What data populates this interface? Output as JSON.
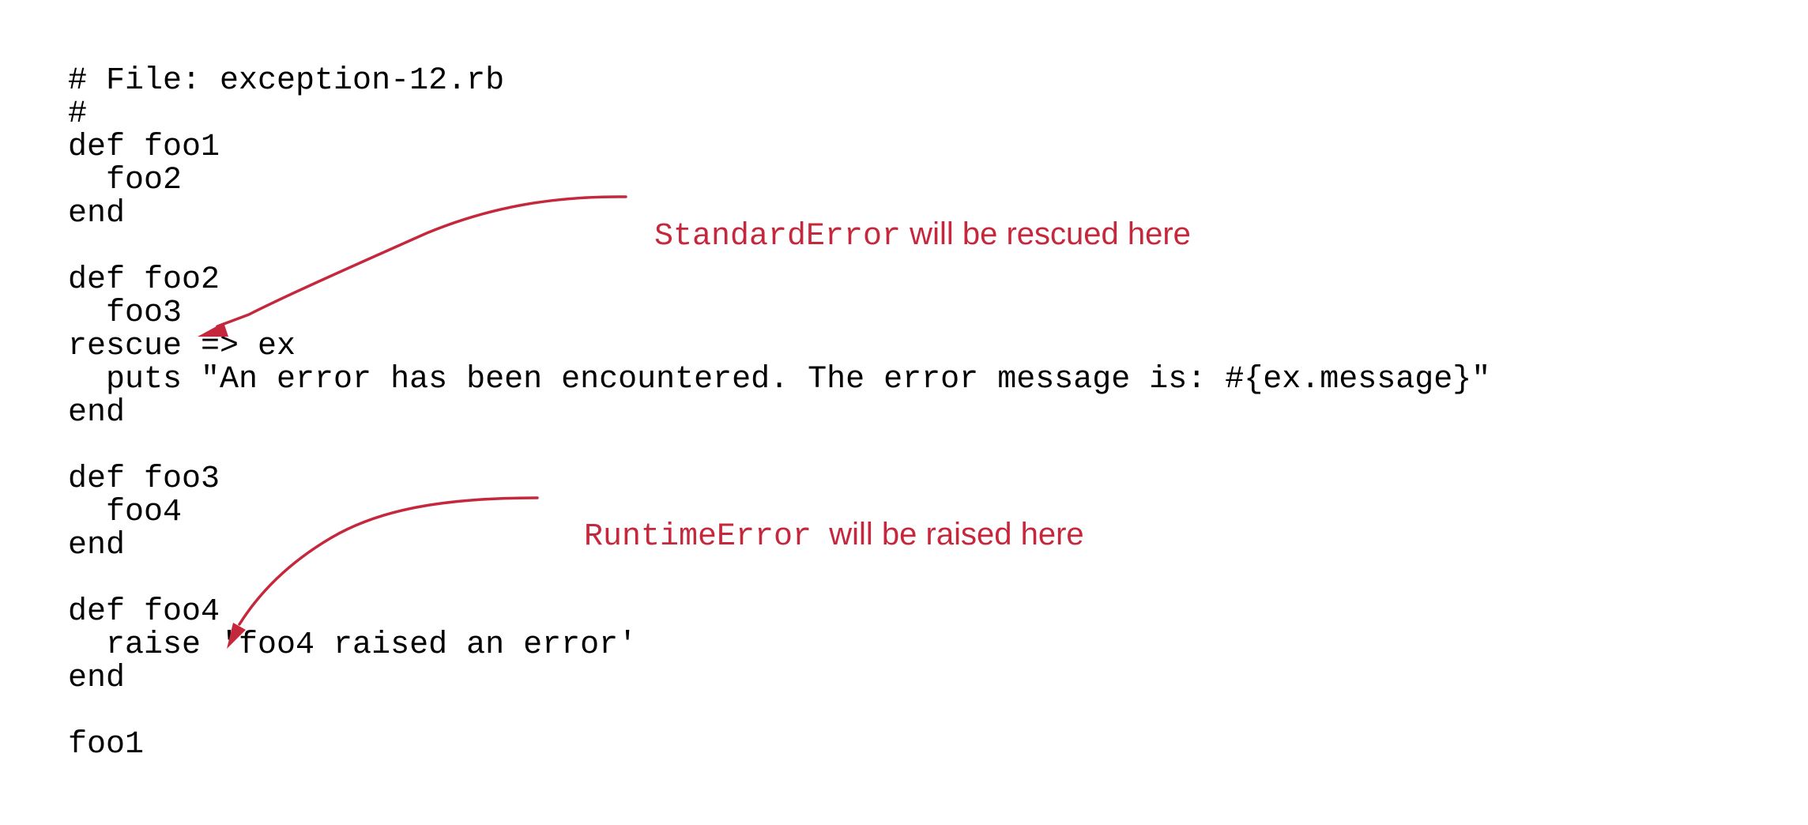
{
  "code_lines": [
    "# File: exception-12.rb",
    "#",
    "def foo1",
    "  foo2",
    "end",
    "",
    "def foo2",
    "  foo3",
    "rescue => ex",
    "  puts \"An error has been encountered. The error message is: #{ex.message}\"",
    "end",
    "",
    "def foo3",
    "  foo4",
    "end",
    "",
    "def foo4",
    "  raise 'foo4 raised an error'",
    "end",
    "",
    "foo1"
  ],
  "annotations": {
    "rescued": {
      "code_term": "StandardError",
      "text": " will be rescued here"
    },
    "raised": {
      "code_term": "RuntimeError",
      "text": "  will be raised here"
    }
  },
  "colors": {
    "annotation": "#c5283d",
    "code": "#000000",
    "background": "#ffffff"
  }
}
